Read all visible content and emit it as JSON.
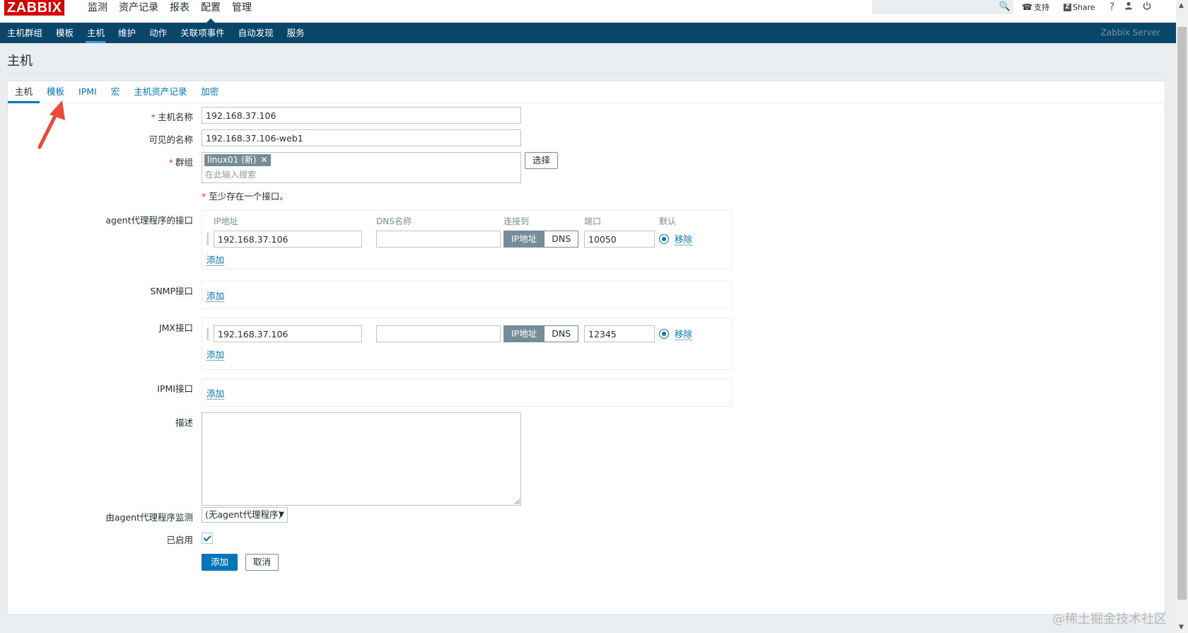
{
  "logo": "ZABBIX",
  "top_menu": [
    {
      "label": "监测",
      "active": false
    },
    {
      "label": "资产记录",
      "active": false
    },
    {
      "label": "报表",
      "active": false
    },
    {
      "label": "配置",
      "active": true
    },
    {
      "label": "管理",
      "active": false
    }
  ],
  "top_right": {
    "search_value": "",
    "support_label": "支持",
    "share_label": "Share",
    "help_label": "?"
  },
  "sub_menu": [
    {
      "label": "主机群组",
      "active": false
    },
    {
      "label": "模板",
      "active": false
    },
    {
      "label": "主机",
      "active": true
    },
    {
      "label": "维护",
      "active": false
    },
    {
      "label": "动作",
      "active": false
    },
    {
      "label": "关联项事件",
      "active": false
    },
    {
      "label": "自动发现",
      "active": false
    },
    {
      "label": "服务",
      "active": false
    }
  ],
  "server_name": "Zabbix Server",
  "page_title": "主机",
  "tabs": [
    {
      "label": "主机",
      "active": true
    },
    {
      "label": "模板",
      "active": false
    },
    {
      "label": "IPMI",
      "active": false
    },
    {
      "label": "宏",
      "active": false
    },
    {
      "label": "主机资产记录",
      "active": false
    },
    {
      "label": "加密",
      "active": false
    }
  ],
  "form": {
    "hostname_label": "主机名称",
    "hostname_value": "192.168.37.106",
    "visible_name_label": "可见的名称",
    "visible_name_value": "192.168.37.106-web1",
    "groups_label": "群组",
    "group_tag": "linux01 (新)",
    "groups_placeholder": "在此输入搜索",
    "select_button": "选择",
    "interface_note": "至少存在一个接口。",
    "columns": {
      "ip": "IP地址",
      "dns": "DNS名称",
      "connect": "连接到",
      "port": "端口",
      "default": "默认"
    },
    "agent_label": "agent代理程序的接口",
    "agent": {
      "ip": "192.168.37.106",
      "dns": "",
      "connect_ip": "IP地址",
      "connect_dns": "DNS",
      "port": "10050",
      "remove": "移除"
    },
    "snmp_label": "SNMP接口",
    "jmx_label": "JMX接口",
    "jmx": {
      "ip": "192.168.37.106",
      "dns": "",
      "connect_ip": "IP地址",
      "connect_dns": "DNS",
      "port": "12345",
      "remove": "移除"
    },
    "ipmi_label": "IPMI接口",
    "add_link": "添加",
    "description_label": "描述",
    "description_value": "",
    "proxy_label": "由agent代理程序监测",
    "proxy_value": "(无agent代理程序)",
    "enabled_label": "已启用",
    "enabled": true,
    "add_button": "添加",
    "cancel_button": "取消"
  },
  "watermark": "@稀土掘金技术社区",
  "colors": {
    "header_bg": "#0a466a",
    "accent": "#0275b8",
    "logo_red": "#d40000",
    "annotation_arrow": "#e84b3c"
  }
}
